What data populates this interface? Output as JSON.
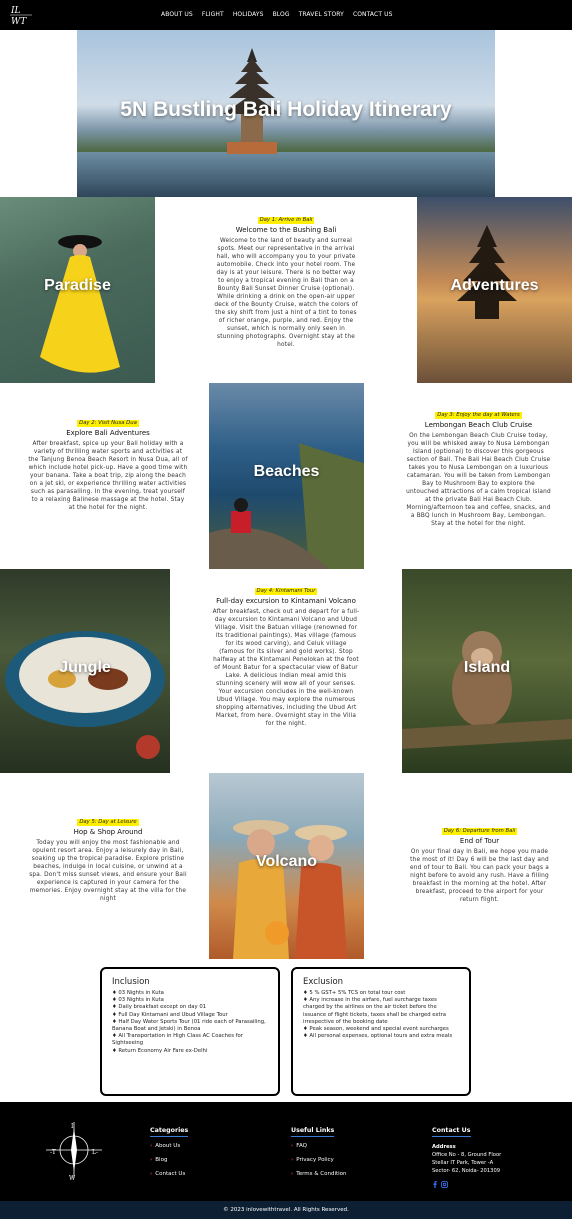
{
  "nav": {
    "logo": "IL WT",
    "items": [
      "ABOUT US",
      "FLIGHT",
      "HOLIDAYS",
      "BLOG",
      "TRAVEL STORY",
      "CONTACT US"
    ]
  },
  "hero": {
    "title": "5N Bustling Bali Holiday Itinerary"
  },
  "tiles": {
    "paradise": "Paradise",
    "adventures": "Adventures",
    "beaches": "Beaches",
    "jungle": "Jungle",
    "island": "Island",
    "volcano": "Volcano"
  },
  "days": [
    {
      "tag": "Day 1: Arrive in Bali",
      "title": "Welcome to the Bushing Bali",
      "text": "Welcome to the land of beauty and surreal spots. Meet our representative in the arrival hall, who will accompany you to your private automobile. Check into your hotel room. The day is at your leisure. There is no better way to enjoy a tropical evening in Bali than on a Bounty Bali Sunset Dinner Cruise (optional). While drinking a drink on the open-air upper deck of the Bounty Cruise, watch the colors of the sky shift from just a hint of a tint to tones of richer orange, purple, and red. Enjoy the sunset, which is normally only seen in stunning photographs. Overnight stay at the hotel."
    },
    {
      "tag": "Day 2: Visit Nusa Dua",
      "title": "Explore Bali Adventures",
      "text": "After breakfast, spice up your Bali holiday with a variety of thrilling water sports and activities at the Tanjung Benoa Beach Resort in Nusa Dua, all of which include hotel pick-up. Have a good time with your banana. Take a boat trip, zip along the beach on a jet ski, or experience thrilling water activities such as parasailing. In the evening, treat yourself to a relaxing Balinese massage at the hotel. Stay at the hotel for the night."
    },
    {
      "tag": "Day 3: Enjoy the day at Waters",
      "title": "Lembongan Beach Club Cruise",
      "text": "On the Lembongan Beach Club Cruise today, you will be whisked away to Nusa Lembongan Island (optional) to discover this gorgeous section of Bali. The Bali Hai Beach Club Cruise takes you to Nusa Lembongan on a luxurious catamaran. You will be taken from Lembongan Bay to Mushroom Bay to explore the untouched attractions of a calm tropical island at the private Bali Hai Beach Club. Morning/afternoon tea and coffee, snacks, and a BBQ lunch in Mushroom Bay, Lembongan. Stay at the hotel for the night."
    },
    {
      "tag": "Day 4: Kintamani Tour",
      "title": "Full-day excursion to Kintamani Volcano",
      "text": "After breakfast, check out and depart for a full-day excursion to Kintamani Volcano and Ubud Village. Visit the Batuan village (renowned for its traditional paintings), Mas village (famous for its wood carving), and Celuk village (famous for its silver and gold works). Stop halfway at the Kintamani Penelokan at the foot of Mount Batur for a spectacular view of Batur Lake. A delicious Indian meal amid this stunning scenery will wow all of your senses. Your excursion concludes in the well-known Ubud Village. You may explore the numerous shopping alternatives, including the Ubud Art Market, from here. Overnight stay in the Villa for the night."
    },
    {
      "tag": "Day 5: Day at Leisure",
      "title": "Hop & Shop Around",
      "text": "Today you will enjoy the most fashionable and opulent resort area. Enjoy a leisurely day in Bali, soaking up the tropical paradise. Explore pristine beaches, indulge in local cuisine, or unwind at a spa. Don't miss sunset views, and ensure your Bali experience is captured in your camera for the memories. Enjoy overnight stay at the villa for the night"
    },
    {
      "tag": "Day 6: Departure from Bali",
      "title": "End of Tour",
      "text": "On your final day in Bali, we hope you made the most of it! Day 6 will be the last day and end of tour to Bali. You can pack your bags a night before to avoid any rush. Have a filling breakfast in the morning at the hotel. After breakfast, proceed to the airport for your return flight."
    }
  ],
  "inclusion": {
    "title": "Inclusion",
    "items": [
      "♦ 03 Nights in Kuta",
      "♦ 03 Nights in Kuta",
      "♦ Daily breakfast except on day 01",
      "♦ Full Day Kintamani and Ubud Village Tour",
      "♦ Half Day Water Sports Tour (01 ride each of Parasailing, Banana Boat and Jetski) in Benoa",
      "♦ All Transportation in High Class AC Coaches for Sightseeing",
      "♦ Return Economy Air Fare ex-Delhi"
    ]
  },
  "exclusion": {
    "title": "Exclusion",
    "items": [
      "♦ 5 % GST+ 5% TCS on total tour cost",
      "♦ Any increase in the airfare, fuel surcharge taxes charged by the airlines on the air ticket before the issuance of flight tickets, taxes shall be charged extra irrespective of the booking date",
      "♦ Peak season, weekend and special event surcharges",
      "♦ All personal expenses, optional tours and extra meals"
    ]
  },
  "footer": {
    "categories": {
      "title": "Categories",
      "links": [
        "About Us",
        "Blog",
        "Contact Us"
      ]
    },
    "useful": {
      "title": "Useful Links",
      "links": [
        "FAQ",
        "Privacy Policy",
        "Terms & Condition"
      ]
    },
    "contact": {
      "title": "Contact Us",
      "addr_label": "Address",
      "addr_lines": [
        "Office No - 8, Ground Floor",
        "Stellar IT Park, Tower -A",
        "Sector- 62, Noida- 201309"
      ]
    },
    "copyright": "© 2023 inlovewithtravel. All Rights Reserved."
  },
  "colors": {
    "highlight": "#ffef00",
    "footer_bg": "#000000",
    "copyright_bg": "#0d2033",
    "link_arrow": "#e33333"
  }
}
